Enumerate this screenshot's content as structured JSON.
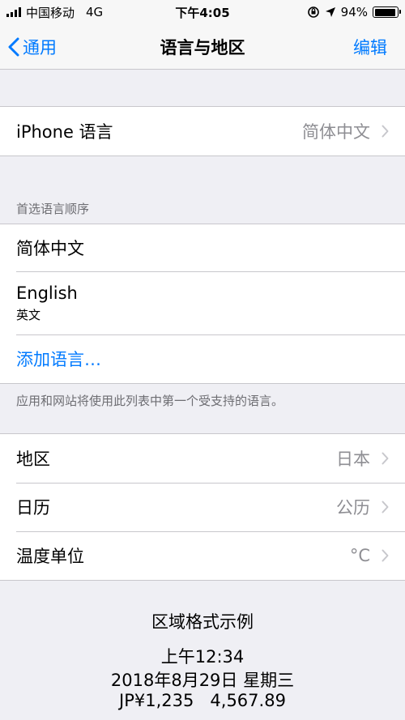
{
  "status_bar": {
    "carrier": "中国移动",
    "network": "4G",
    "time": "下午4:05",
    "battery_percent": "94%",
    "battery_level": 0.94
  },
  "nav": {
    "back_label": "通用",
    "title": "语言与地区",
    "edit_label": "编辑"
  },
  "iphone_language": {
    "label": "iPhone 语言",
    "value": "简体中文"
  },
  "preferred_order": {
    "header": "首选语言顺序",
    "languages": [
      {
        "name": "简体中文"
      },
      {
        "name": "English",
        "native": "英文"
      }
    ],
    "add_label": "添加语言…",
    "footer": "应用和网站将使用此列表中第一个受支持的语言。"
  },
  "region_settings": [
    {
      "label": "地区",
      "value": "日本"
    },
    {
      "label": "日历",
      "value": "公历"
    },
    {
      "label": "温度单位",
      "value": "°C"
    }
  ],
  "format_example": {
    "title": "区域格式示例",
    "time": "上午12:34",
    "date": "2018年8月29日 星期三",
    "numbers": "JP¥1,235   4,567.89"
  },
  "colors": {
    "accent": "#007aff",
    "background": "#efeff4",
    "secondary_text": "#8e8e93"
  }
}
